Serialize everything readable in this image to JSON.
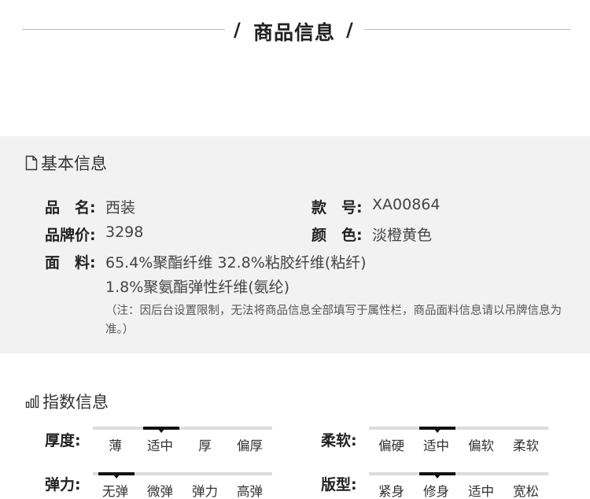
{
  "header": {
    "slash": "/",
    "title": "商品信息"
  },
  "basic": {
    "heading": "基本信息",
    "name_label": "品　名:",
    "name_value": "西装",
    "model_label": "款　号:",
    "model_value": "XA00864",
    "price_label": "品牌价:",
    "price_value": "3298",
    "color_label": "颜　色:",
    "color_value": "淡橙黄色",
    "fabric_label": "面　料:",
    "fabric_line1": "65.4%聚酯纤维 32.8%粘胶纤维(粘纤)",
    "fabric_line2": "1.8%聚氨酯弹性纤维(氨纶)",
    "note": "（注：因后台设置限制，无法将商品信息全部填写于属性栏，商品面料信息请以吊牌信息为准。）"
  },
  "index": {
    "heading": "指数信息",
    "scales": [
      {
        "label": "厚度:",
        "options": [
          "薄",
          "适中",
          "厚",
          "偏厚"
        ],
        "selected": 1
      },
      {
        "label": "柔软:",
        "options": [
          "偏硬",
          "适中",
          "偏软",
          "柔软"
        ],
        "selected": 1
      },
      {
        "label": "弹力:",
        "options": [
          "无弹",
          "微弹",
          "弹力",
          "高弹"
        ],
        "selected": 0
      },
      {
        "label": "版型:",
        "options": [
          "紧身",
          "修身",
          "适中",
          "宽松"
        ],
        "selected": 1
      }
    ]
  },
  "colors": {
    "panel_bg": "#f2f2f2",
    "scale_track": "#dcdcdc",
    "scale_active": "#111111"
  },
  "icons": {
    "basic": "document-icon",
    "index": "bar-chart-icon"
  }
}
